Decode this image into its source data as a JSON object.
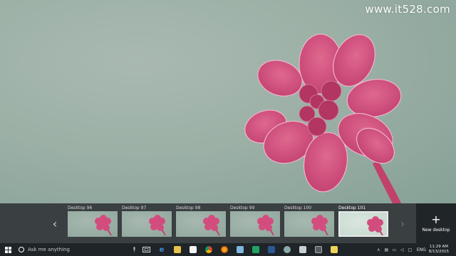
{
  "watermark": "www.it528.com",
  "task_view": {
    "desktops": [
      {
        "label": "Desktop 96"
      },
      {
        "label": "Desktop 97"
      },
      {
        "label": "Desktop 98"
      },
      {
        "label": "Desktop 99"
      },
      {
        "label": "Desktop 100"
      },
      {
        "label": "Desktop 101",
        "active": true
      }
    ],
    "prev_icon": "chevron-left-icon",
    "next_icon": "chevron-right-icon",
    "new_desktop_label": "New desktop",
    "new_desktop_icon": "plus-icon"
  },
  "taskbar": {
    "search_placeholder": "Ask me anything",
    "apps": [
      "task-view-icon",
      "edge-icon",
      "file-explorer-icon",
      "store-icon",
      "chrome-icon",
      "firefox-icon",
      "app-icon",
      "excel-icon",
      "word-icon",
      "app-icon",
      "app-icon",
      "calculator-icon",
      "folder-icon"
    ],
    "language": "ENG",
    "time": "11:29 AM",
    "date": "8/13/2015"
  },
  "colors": {
    "taskbar": "#1e2427",
    "task_view_strip": "#2b3034",
    "flower": "#d8477f",
    "wallpaper": "#9cb0a6"
  }
}
